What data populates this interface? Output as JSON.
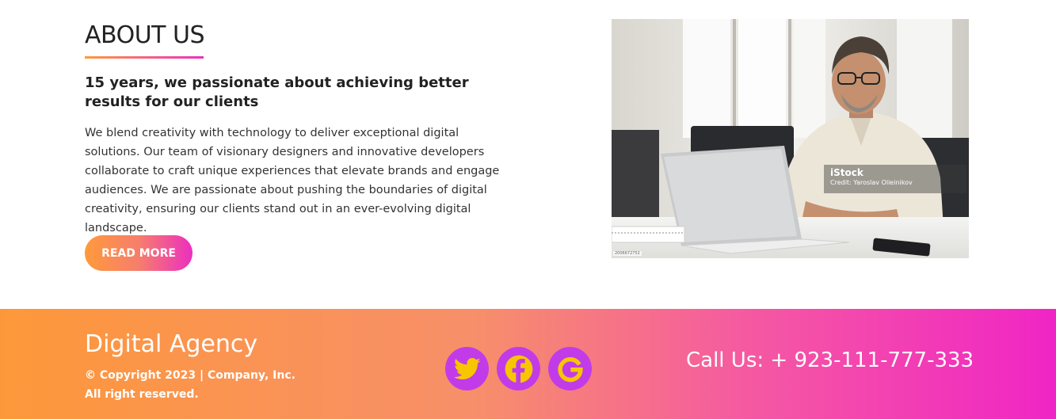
{
  "about": {
    "title": "ABOUT US",
    "heading": "15 years, we passionate about achieving better results for our clients",
    "body": "We blend creativity with technology to deliver exceptional digital solutions. Our team of visionary designers and innovative developers collaborate to craft unique experiences that elevate brands and engage audiences. We are passionate about pushing the boundaries of digital creativity, ensuring our clients stand out in an ever-evolving digital landscape.",
    "button_label": "READ MORE"
  },
  "photo": {
    "watermark_brand": "iStock",
    "watermark_credit": "Credit: Yaroslav Olieinikov",
    "stock_id": "2006672752"
  },
  "footer": {
    "brand": "Digital Agency",
    "copyright_line1": "© Copyright 2023 | Company, Inc.",
    "copyright_line2": "All right reserved.",
    "social": [
      {
        "name": "twitter-icon"
      },
      {
        "name": "facebook-icon"
      },
      {
        "name": "google-icon"
      }
    ],
    "phone": "Call Us: + 923-111-777-333"
  },
  "colors": {
    "accent_orange": "#ff9a3c",
    "accent_pink": "#ec2fc0",
    "social_bg": "#c23be8",
    "social_icon": "#f7c600"
  }
}
